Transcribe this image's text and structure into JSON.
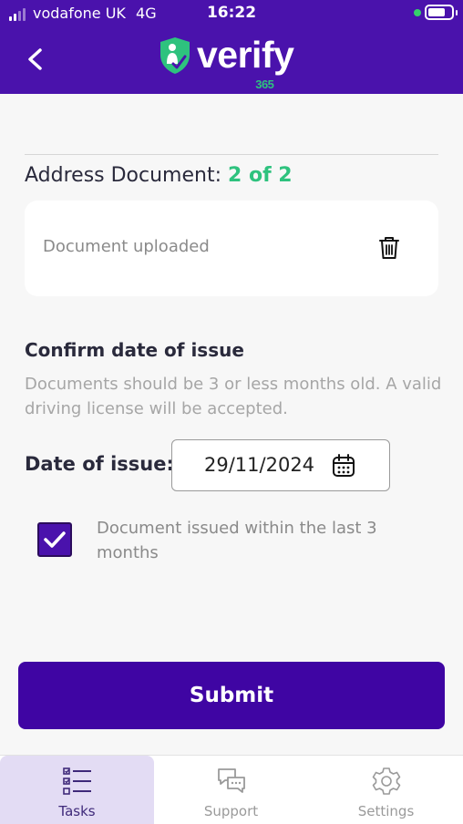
{
  "status_bar": {
    "carrier": "vodafone UK",
    "network": "4G",
    "time": "16:22",
    "battery_level": 0.75
  },
  "header": {
    "logo_text": "verify",
    "logo_sub": "365",
    "colors": {
      "background": "#4a12ac",
      "accent": "#2ec27e"
    }
  },
  "address_document": {
    "label": "Address Document:",
    "count": "2 of 2",
    "upload_status": "Document uploaded"
  },
  "confirm": {
    "title": "Confirm date of issue",
    "description": "Documents should be 3 or less months old. A valid driving license will be accepted.",
    "date_label": "Date of issue:",
    "date_value": "29/11/2024",
    "checkbox_label": "Document issued within the last 3 months",
    "checkbox_checked": true
  },
  "submit_label": "Submit",
  "tabs": [
    {
      "label": "Tasks",
      "icon": "tasks-icon",
      "active": true
    },
    {
      "label": "Support",
      "icon": "chat-icon",
      "active": false
    },
    {
      "label": "Settings",
      "icon": "gear-icon",
      "active": false
    }
  ]
}
